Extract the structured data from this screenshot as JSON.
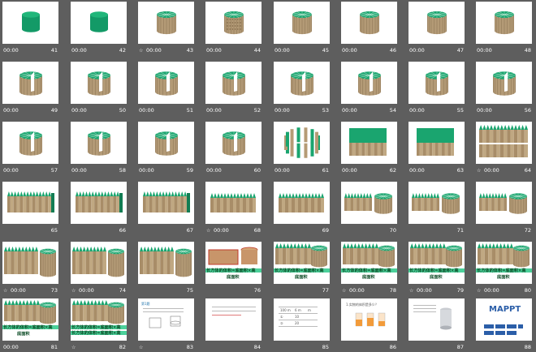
{
  "slides": [
    {
      "time": "00:00",
      "num": "41",
      "kind": "cyl-solid",
      "star": false
    },
    {
      "time": "00:00",
      "num": "42",
      "kind": "cyl-solid",
      "star": false
    },
    {
      "time": "00:00",
      "num": "43",
      "kind": "cyl-slice",
      "star": true
    },
    {
      "time": "00:00",
      "num": "44",
      "kind": "cyl-dots",
      "star": false
    },
    {
      "time": "00:00",
      "num": "45",
      "kind": "cyl-slice",
      "star": false
    },
    {
      "time": "00:00",
      "num": "46",
      "kind": "cyl-slice",
      "star": false
    },
    {
      "time": "00:00",
      "num": "47",
      "kind": "cyl-slice",
      "star": false
    },
    {
      "time": "00:00",
      "num": "48",
      "kind": "cyl-slice",
      "star": false
    },
    {
      "time": "00:00",
      "num": "49",
      "kind": "cyl-open",
      "star": false
    },
    {
      "time": "00:00",
      "num": "50",
      "kind": "cyl-open",
      "star": false
    },
    {
      "time": "00:00",
      "num": "51",
      "kind": "cyl-open",
      "star": false
    },
    {
      "time": "00:00",
      "num": "52",
      "kind": "cyl-open",
      "star": false
    },
    {
      "time": "00:00",
      "num": "53",
      "kind": "cyl-open",
      "star": false
    },
    {
      "time": "00:00",
      "num": "54",
      "kind": "cyl-open",
      "star": false
    },
    {
      "time": "00:00",
      "num": "55",
      "kind": "cyl-open",
      "star": false
    },
    {
      "time": "00:00",
      "num": "56",
      "kind": "cyl-open",
      "star": false
    },
    {
      "time": "00:00",
      "num": "57",
      "kind": "cyl-open",
      "star": false
    },
    {
      "time": "00:00",
      "num": "58",
      "kind": "cyl-open",
      "star": false
    },
    {
      "time": "00:00",
      "num": "59",
      "kind": "cyl-open",
      "star": false
    },
    {
      "time": "00:00",
      "num": "60",
      "kind": "cyl-open",
      "star": false
    },
    {
      "time": "00:00",
      "num": "61",
      "kind": "ring",
      "star": false
    },
    {
      "time": "00:00",
      "num": "62",
      "kind": "unroll",
      "star": false
    },
    {
      "time": "00:00",
      "num": "63",
      "kind": "unroll",
      "star": false
    },
    {
      "time": "00:00",
      "num": "64",
      "kind": "unroll2",
      "star": true
    },
    {
      "time": "",
      "num": "65",
      "kind": "box",
      "star": false
    },
    {
      "time": "",
      "num": "66",
      "kind": "box",
      "star": false
    },
    {
      "time": "",
      "num": "67",
      "kind": "box",
      "star": false
    },
    {
      "time": "00:00",
      "num": "68",
      "kind": "box2",
      "star": true
    },
    {
      "time": "",
      "num": "69",
      "kind": "box2",
      "star": false
    },
    {
      "time": "",
      "num": "70",
      "kind": "pair",
      "star": false
    },
    {
      "time": "",
      "num": "71",
      "kind": "pair",
      "star": false
    },
    {
      "time": "",
      "num": "72",
      "kind": "pair",
      "star": false
    },
    {
      "time": "00:00",
      "num": "73",
      "kind": "pair-lg",
      "star": true
    },
    {
      "time": "00:00",
      "num": "74",
      "kind": "pair-lg",
      "star": true
    },
    {
      "time": "",
      "num": "75",
      "kind": "pair-lg",
      "star": false
    },
    {
      "time": "",
      "num": "76",
      "kind": "pair-orange",
      "star": false
    },
    {
      "time": "",
      "num": "77",
      "kind": "pair-text",
      "star": false
    },
    {
      "time": "00:00",
      "num": "78",
      "kind": "pair-text",
      "star": true
    },
    {
      "time": "00:00",
      "num": "79",
      "kind": "pair-text",
      "star": true
    },
    {
      "time": "00:00",
      "num": "80",
      "kind": "pair-text",
      "star": true
    },
    {
      "time": "00:00",
      "num": "81",
      "kind": "pair-text-b",
      "star": false
    },
    {
      "time": "",
      "num": "82",
      "kind": "pair-text-c",
      "star": true
    },
    {
      "time": "",
      "num": "83",
      "kind": "exercise",
      "star": true
    },
    {
      "time": "",
      "num": "84",
      "kind": "text",
      "star": false
    },
    {
      "time": "",
      "num": "85",
      "kind": "table",
      "star": false
    },
    {
      "time": "",
      "num": "86",
      "kind": "beakers",
      "star": false
    },
    {
      "time": "",
      "num": "87",
      "kind": "vase",
      "star": false
    },
    {
      "time": "",
      "num": "88",
      "kind": "ppt",
      "star": false
    }
  ],
  "labels": {
    "formula": "长方体的体积=底面积×高",
    "base_area": "底面积",
    "ppt_title": "MAPPT",
    "q_title": "第1题",
    "t85_a": "100 m",
    "t85_b": "6 m",
    "t85_c": "m",
    "t85_r1": "①",
    "t85_r2": "②",
    "t85_v1": "10",
    "t85_v2": "20",
    "t86_title": "1.实物的体积是多少？"
  },
  "colors": {
    "green": "#1aa56f",
    "tan": "#b39a76",
    "formula_bar": "#4bd09a"
  }
}
